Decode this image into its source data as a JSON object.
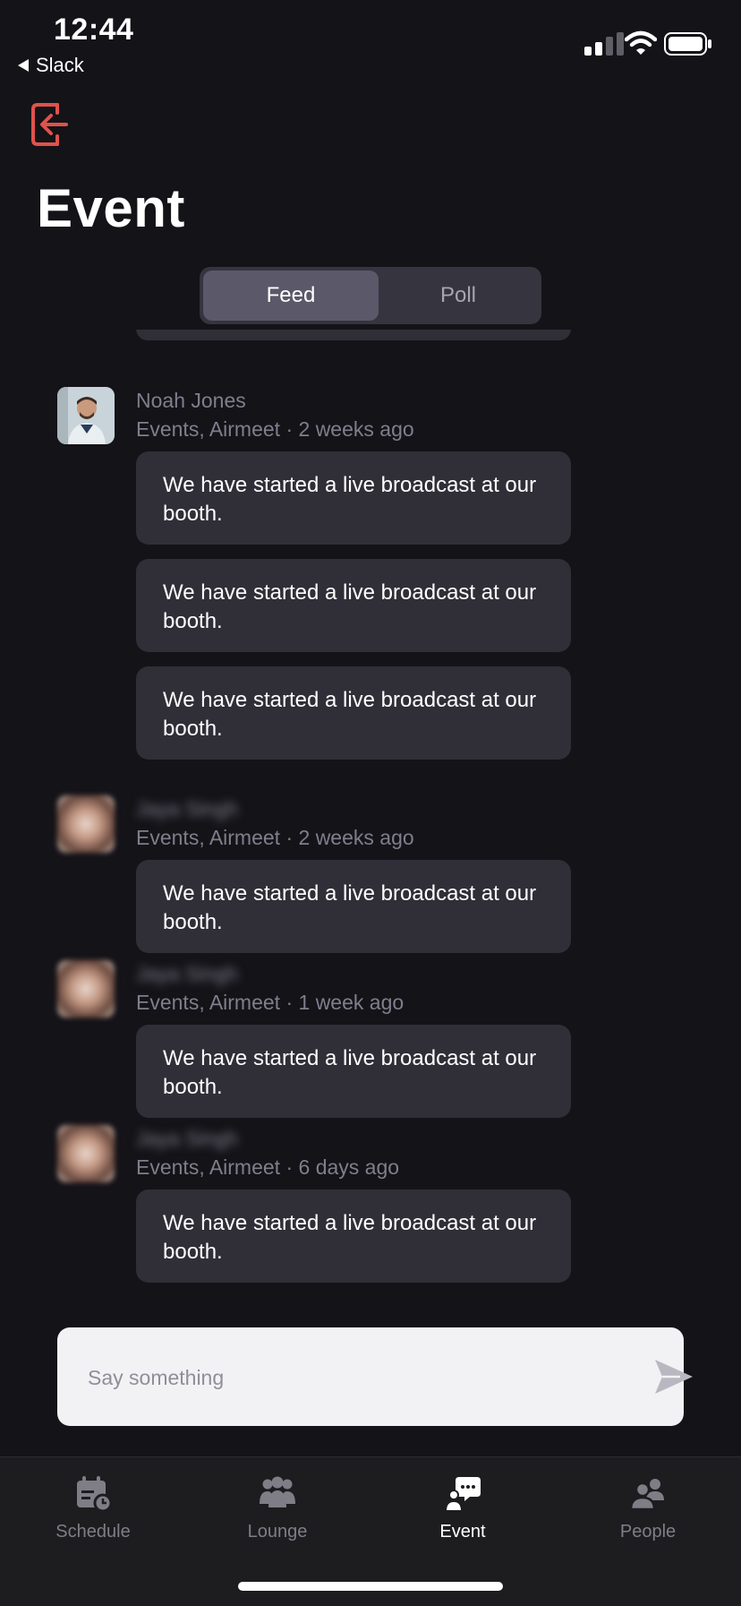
{
  "status_bar": {
    "time": "12:44",
    "back_app": "Slack"
  },
  "header": {
    "title": "Event",
    "exit_icon": "exit-icon"
  },
  "tabs": {
    "feed": "Feed",
    "poll": "Poll",
    "selected": "Feed"
  },
  "posts": [
    {
      "author": "Noah Jones",
      "meta": "Events, Airmeet · 2 weeks ago",
      "messages": [
        "We have started a live broadcast at our booth.",
        "We have started a live broadcast at our booth.",
        "We have started a live broadcast at our booth."
      ]
    },
    {
      "author": "Jaya Singh",
      "meta": "Events, Airmeet · 2 weeks ago",
      "messages": [
        "We have started a live broadcast at our booth."
      ]
    },
    {
      "author": "Jaya Singh",
      "meta": "Events, Airmeet · 1 week ago",
      "messages": [
        "We have started a live broadcast at our booth."
      ]
    },
    {
      "author": "Jaya Singh",
      "meta": "Events, Airmeet · 6 days ago",
      "messages": [
        "We have started a live broadcast at our booth."
      ]
    }
  ],
  "composer": {
    "placeholder": "Say something"
  },
  "bottom_nav": {
    "schedule": "Schedule",
    "lounge": "Lounge",
    "event": "Event",
    "people": "People",
    "active": "Event"
  },
  "colors": {
    "background": "#141318",
    "bubble": "#302f38",
    "accent_exit": "#e0524c",
    "muted_text": "#807e8c"
  }
}
